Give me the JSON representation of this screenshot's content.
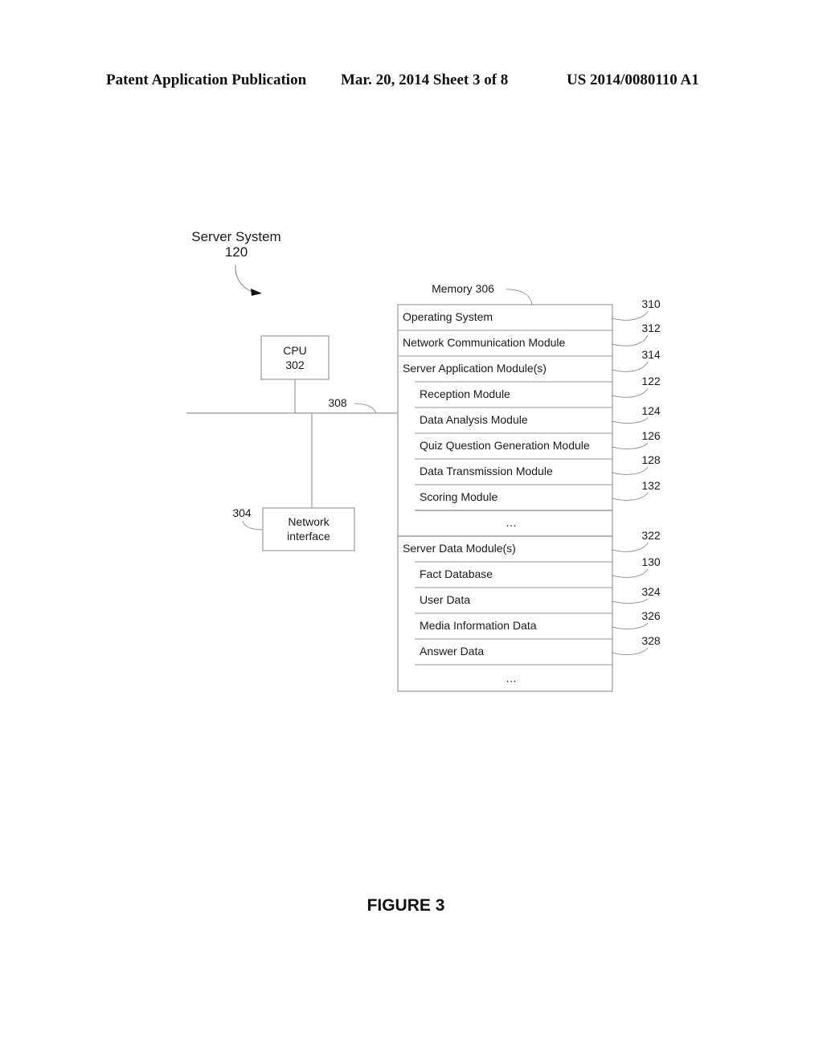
{
  "header": {
    "left": "Patent Application Publication",
    "middle": "Mar. 20, 2014  Sheet 3 of 8",
    "right": "US 2014/0080110 A1"
  },
  "diagram": {
    "system_label": "Server System",
    "system_ref": "120",
    "cpu": {
      "label": "CPU",
      "ref": "302"
    },
    "network_interface": {
      "label_line1": "Network",
      "label_line2": "interface",
      "ref": "304"
    },
    "bus_ref": "308",
    "memory": {
      "label": "Memory 306",
      "rows": [
        {
          "text": "Operating System",
          "ref": "310",
          "indent": false
        },
        {
          "text": "Network Communication Module",
          "ref": "312",
          "indent": false
        },
        {
          "text": "Server Application Module(s)",
          "ref": "314",
          "indent": false
        },
        {
          "text": "Reception Module",
          "ref": "122",
          "indent": true
        },
        {
          "text": "Data Analysis Module",
          "ref": "124",
          "indent": true
        },
        {
          "text": "Quiz Question Generation Module",
          "ref": "126",
          "indent": true
        },
        {
          "text": "Data Transmission Module",
          "ref": "128",
          "indent": true
        },
        {
          "text": "Scoring Module",
          "ref": "132",
          "indent": true
        },
        {
          "text": "...",
          "ref": "",
          "indent": true
        },
        {
          "text": "Server Data Module(s)",
          "ref": "322",
          "indent": false
        },
        {
          "text": "Fact Database",
          "ref": "130",
          "indent": true
        },
        {
          "text": "User Data",
          "ref": "324",
          "indent": true
        },
        {
          "text": "Media Information Data",
          "ref": "326",
          "indent": true
        },
        {
          "text": "Answer Data",
          "ref": "328",
          "indent": true
        },
        {
          "text": "...",
          "ref": "",
          "indent": true
        }
      ]
    }
  },
  "figure_caption": "FIGURE 3"
}
